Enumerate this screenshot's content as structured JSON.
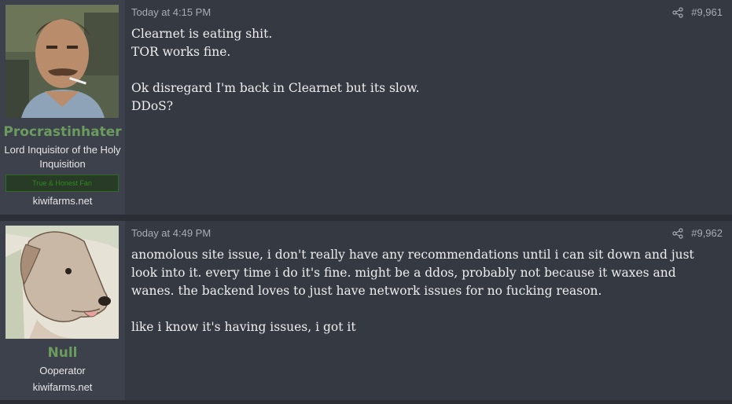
{
  "posts": [
    {
      "username": "Procrastinhater",
      "user_title": "Lord Inquisitor of the Holy Inquisition",
      "banner": "True & Honest Fan",
      "site": "kiwifarms.net",
      "timestamp": "Today at 4:15 PM",
      "post_number": "#9,961",
      "paragraphs": [
        [
          "Clearnet is eating shit.",
          "TOR works fine."
        ],
        [
          "Ok disregard I'm back in Clearnet but its slow.",
          "DDoS?"
        ]
      ]
    },
    {
      "username": "Null",
      "user_title": "Ooperator",
      "site": "kiwifarms.net",
      "timestamp": "Today at 4:49 PM",
      "post_number": "#9,962",
      "paragraphs": [
        [
          "anomolous site issue, i don't really have any recommendations until i can sit down and just look into it. every time i do it's fine. might be a ddos, probably not because it waxes and wanes. the backend loves to just have network issues for no fucking reason."
        ],
        [
          "like i know it's having issues, i got it"
        ]
      ]
    }
  ],
  "colors": {
    "username": "#6b9c5e",
    "banner_text": "#2f8a1f",
    "post_bg": "#353942",
    "user_panel_bg": "#3c414b"
  },
  "icons": [
    "share-icon"
  ]
}
